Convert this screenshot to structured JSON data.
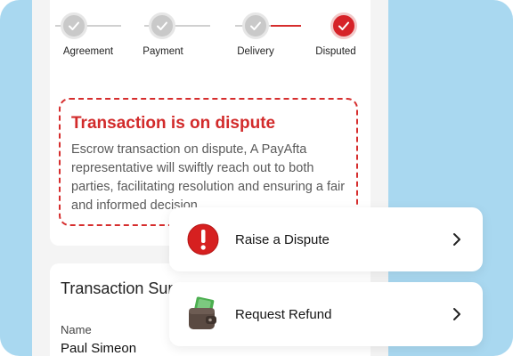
{
  "colors": {
    "background": "#a9d8f0",
    "accent_red": "#d62d2d",
    "step_done": "#c9c9c9"
  },
  "stepper": {
    "steps": [
      {
        "label": "Agreement",
        "state": "done"
      },
      {
        "label": "Payment",
        "state": "done"
      },
      {
        "label": "Delivery",
        "state": "done"
      },
      {
        "label": "Disputed",
        "state": "active"
      }
    ]
  },
  "dispute": {
    "title": "Transaction is on dispute",
    "body": "Escrow transaction on dispute, A PayAfta representative will swiftly reach out to both parties, facilitating resolution and ensuring a fair and informed decision."
  },
  "summary": {
    "title": "Transaction Summary",
    "name_label": "Name",
    "name_value": "Paul Simeon"
  },
  "actions": [
    {
      "label": "Raise a Dispute",
      "icon": "exclamation-icon"
    },
    {
      "label": "Request Refund",
      "icon": "wallet-money-icon"
    }
  ]
}
